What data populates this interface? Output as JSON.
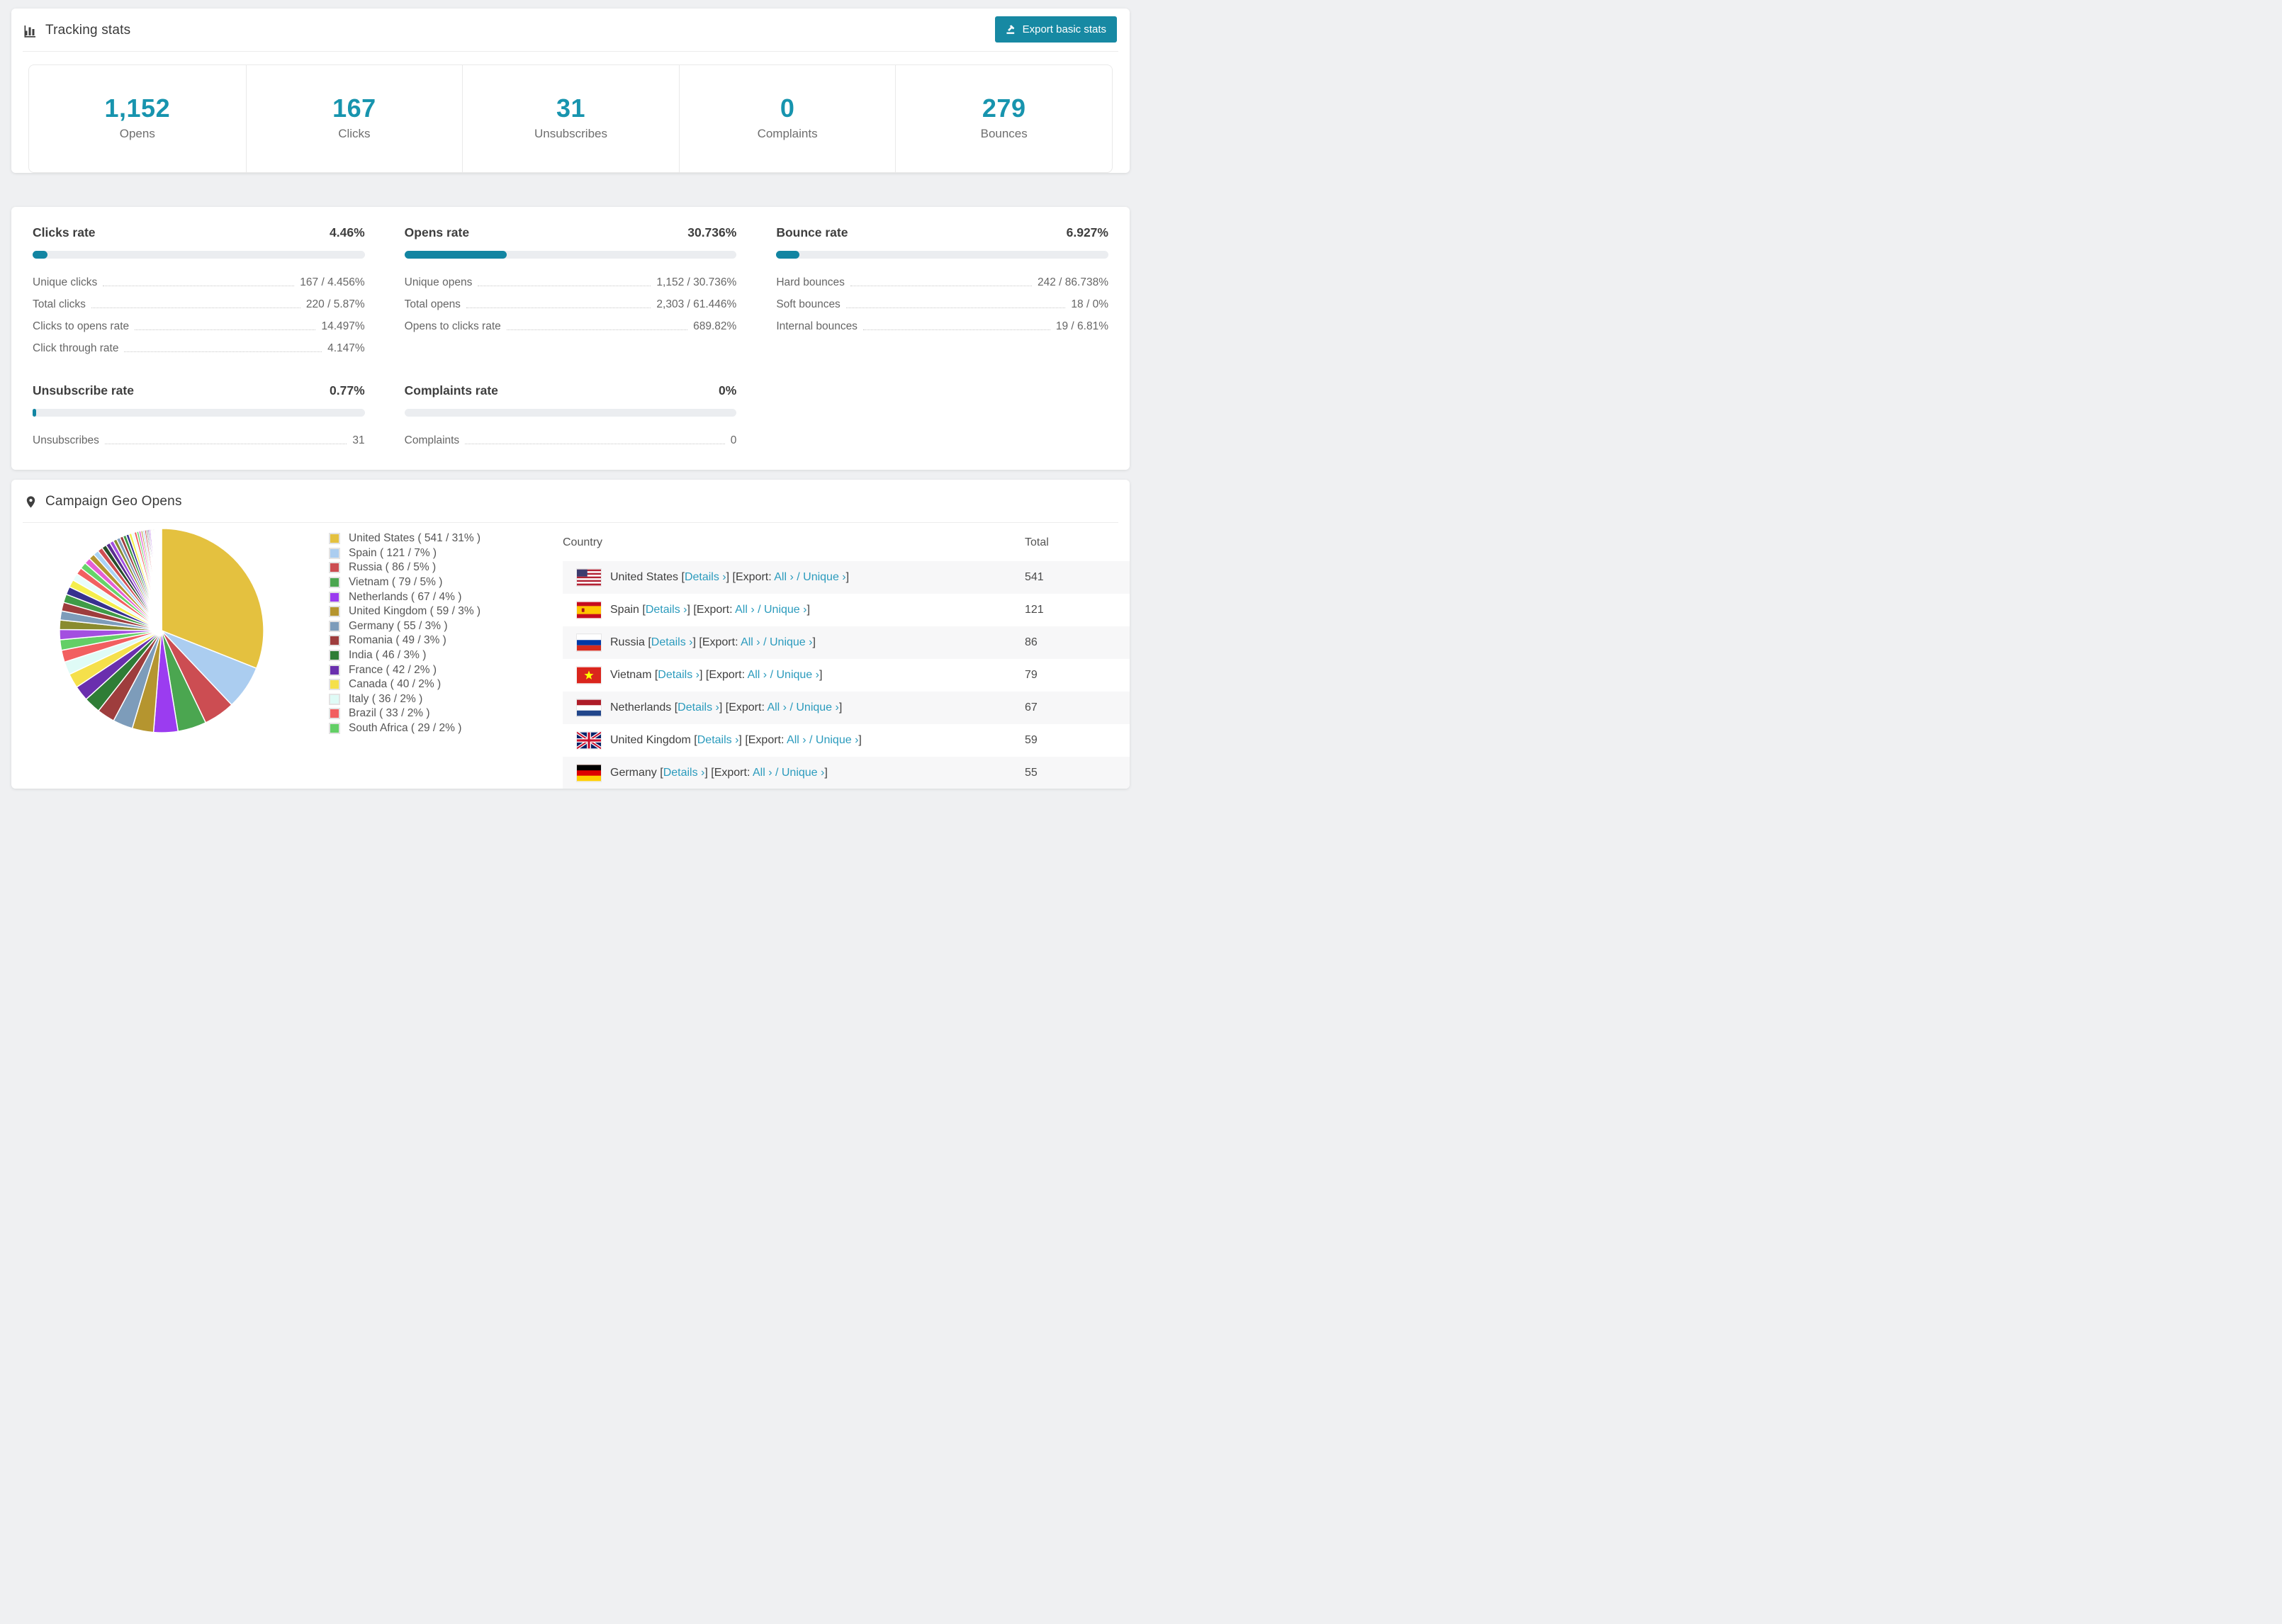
{
  "page": {
    "background": "#eff0f2"
  },
  "colors": {
    "accent_teal": "#1789a3",
    "stat_number": "#1794ae",
    "progress_fill": "#1285a2",
    "progress_track": "#ebedf0",
    "link": "#2b9bbd",
    "row_stripe": "#f7f7f8"
  },
  "tracking": {
    "title": "Tracking stats",
    "export_button_label": "Export basic stats",
    "stats": [
      {
        "value": "1,152",
        "label": "Opens"
      },
      {
        "value": "167",
        "label": "Clicks"
      },
      {
        "value": "31",
        "label": "Unsubscribes"
      },
      {
        "value": "0",
        "label": "Complaints"
      },
      {
        "value": "279",
        "label": "Bounces"
      }
    ]
  },
  "rates": {
    "blocks": [
      {
        "title": "Clicks rate",
        "value": "4.46%",
        "percent": 4.46,
        "rows": [
          {
            "label": "Unique clicks",
            "value": "167 / 4.456%"
          },
          {
            "label": "Total clicks",
            "value": "220 / 5.87%"
          },
          {
            "label": "Clicks to opens rate",
            "value": "14.497%"
          },
          {
            "label": "Click through rate",
            "value": "4.147%"
          }
        ]
      },
      {
        "title": "Opens rate",
        "value": "30.736%",
        "percent": 30.736,
        "rows": [
          {
            "label": "Unique opens",
            "value": "1,152 / 30.736%"
          },
          {
            "label": "Total opens",
            "value": "2,303 / 61.446%"
          },
          {
            "label": "Opens to clicks rate",
            "value": "689.82%"
          }
        ]
      },
      {
        "title": "Bounce rate",
        "value": "6.927%",
        "percent": 6.927,
        "rows": [
          {
            "label": "Hard bounces",
            "value": "242 / 86.738%"
          },
          {
            "label": "Soft bounces",
            "value": "18 / 0%"
          },
          {
            "label": "Internal bounces",
            "value": "19 / 6.81%"
          }
        ]
      },
      {
        "title": "Unsubscribe rate",
        "value": "0.77%",
        "percent": 0.77,
        "rows": [
          {
            "label": "Unsubscribes",
            "value": "31"
          }
        ]
      },
      {
        "title": "Complaints rate",
        "value": "0%",
        "percent": 0,
        "rows": [
          {
            "label": "Complaints",
            "value": "0"
          }
        ]
      }
    ]
  },
  "geo": {
    "title": "Campaign Geo Opens",
    "table": {
      "headers": [
        "Country",
        "Total"
      ],
      "links": {
        "details": "Details ›",
        "export_prefix": "Export:",
        "all": "All ›",
        "unique": "Unique ›"
      },
      "rows": [
        {
          "country": "United States",
          "flag": "us",
          "total": "541"
        },
        {
          "country": "Spain",
          "flag": "es",
          "total": "121"
        },
        {
          "country": "Russia",
          "flag": "ru",
          "total": "86"
        },
        {
          "country": "Vietnam",
          "flag": "vn",
          "total": "79"
        },
        {
          "country": "Netherlands",
          "flag": "nl",
          "total": "67"
        },
        {
          "country": "United Kingdom",
          "flag": "gb",
          "total": "59"
        },
        {
          "country": "Germany",
          "flag": "de",
          "total": "55",
          "partial": true
        }
      ]
    },
    "chart_data": {
      "type": "pie",
      "title": "Campaign Geo Opens",
      "legend_position": "right-of-pie",
      "start_angle": "12-o-clock-clockwise",
      "series": [
        {
          "name": "United States",
          "count": 541,
          "pct": "31%",
          "color": "#e4c13f"
        },
        {
          "name": "Spain",
          "count": 121,
          "pct": "7%",
          "color": "#abcdf0"
        },
        {
          "name": "Russia",
          "count": 86,
          "pct": "5%",
          "color": "#cc4d52"
        },
        {
          "name": "Vietnam",
          "count": 79,
          "pct": "5%",
          "color": "#4ba650"
        },
        {
          "name": "Netherlands",
          "count": 67,
          "pct": "4%",
          "color": "#9b3cf0"
        },
        {
          "name": "United Kingdom",
          "count": 59,
          "pct": "3%",
          "color": "#b5952f"
        },
        {
          "name": "Germany",
          "count": 55,
          "pct": "3%",
          "color": "#7d9cba"
        },
        {
          "name": "Romania",
          "count": 49,
          "pct": "3%",
          "color": "#9e3d3d"
        },
        {
          "name": "India",
          "count": 46,
          "pct": "3%",
          "color": "#2f7d36"
        },
        {
          "name": "France",
          "count": 42,
          "pct": "2%",
          "color": "#6a2fae"
        },
        {
          "name": "Canada",
          "count": 40,
          "pct": "2%",
          "color": "#f5e04b"
        },
        {
          "name": "Italy",
          "count": 36,
          "pct": "2%",
          "color": "#dffbf6"
        },
        {
          "name": "Brazil",
          "count": 33,
          "pct": "2%",
          "color": "#f25f60"
        },
        {
          "name": "South Africa",
          "count": 29,
          "pct": "2%",
          "color": "#63cf66"
        }
      ],
      "others_unlabeled_approx": {
        "values": [
          28,
          26,
          25,
          24,
          23,
          22,
          21,
          20,
          19,
          18,
          17,
          16,
          15,
          14,
          13,
          12,
          11,
          10,
          10,
          9,
          9,
          8,
          8,
          7,
          7,
          6,
          6,
          5,
          5,
          5,
          4,
          4,
          4,
          3,
          3,
          3,
          3,
          2,
          2,
          2,
          2,
          2,
          1,
          1,
          1,
          1,
          1,
          1,
          1,
          1
        ],
        "palette": [
          "#a34fe0",
          "#8a8b2f",
          "#7d9cba",
          "#9e3d3d",
          "#3f9b47",
          "#37308f",
          "#f5ee4d",
          "#e8fdfb",
          "#f26060",
          "#66d469",
          "#e45fd5",
          "#b5952f",
          "#a9d3f5",
          "#cf4d52",
          "#274d2a",
          "#5a2d91"
        ]
      }
    }
  }
}
